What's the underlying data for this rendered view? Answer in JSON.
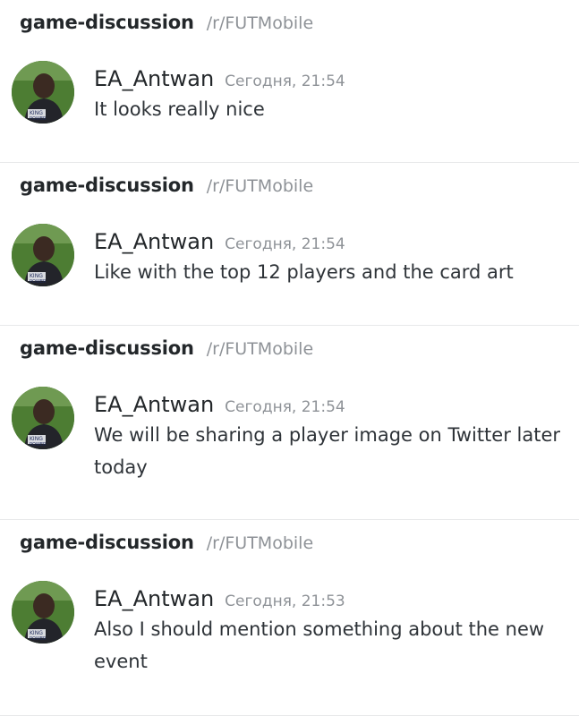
{
  "colors": {
    "channel": "#23272a",
    "muted": "#8e9297",
    "text": "#2e3338",
    "divider": "#e8e9ea"
  },
  "messages": [
    {
      "channel": "game-discussion",
      "server": "/r/FUTMobile",
      "author": "EA_Antwan",
      "timestamp": "Сегодня, 21:54",
      "text": "It looks really nice",
      "avatar_icon": "player-avatar"
    },
    {
      "channel": "game-discussion",
      "server": "/r/FUTMobile",
      "author": "EA_Antwan",
      "timestamp": "Сегодня, 21:54",
      "text": "Like with the top 12 players and the card art",
      "avatar_icon": "player-avatar"
    },
    {
      "channel": "game-discussion",
      "server": "/r/FUTMobile",
      "author": "EA_Antwan",
      "timestamp": "Сегодня, 21:54",
      "text": "We will be sharing a player image on Twitter later today",
      "avatar_icon": "player-avatar"
    },
    {
      "channel": "game-discussion",
      "server": "/r/FUTMobile",
      "author": "EA_Antwan",
      "timestamp": "Сегодня, 21:53",
      "text": "Also I should mention something about the new event",
      "avatar_icon": "player-avatar"
    }
  ]
}
